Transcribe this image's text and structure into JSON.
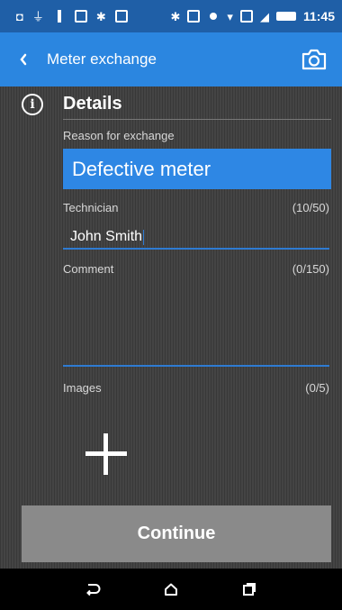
{
  "status_bar": {
    "time": "11:45",
    "icons": [
      "cast-icon",
      "usb-icon",
      "info-icon",
      "screenshot-icon",
      "bluetooth-icon",
      "gallery-icon",
      "bluetooth-icon",
      "nfc-icon",
      "data-icon",
      "wifi-icon",
      "storage-icon",
      "signal-icon",
      "battery-icon"
    ]
  },
  "app_bar": {
    "title": "Meter exchange",
    "back_icon": "back-arrow-icon",
    "camera_icon": "camera-icon"
  },
  "details": {
    "title": "Details",
    "reason_label": "Reason for exchange",
    "reason_value": "Defective meter",
    "technician_label": "Technician",
    "technician_counter": "(10/50)",
    "technician_value": "John Smith",
    "comment_label": "Comment",
    "comment_counter": "(0/150)",
    "comment_value": "",
    "images_label": "Images",
    "images_counter": "(0/5)"
  },
  "continue_label": "Continue",
  "colors": {
    "status_bar": "#1f5fa7",
    "app_bar": "#2b86e0",
    "accent": "#2e87e4",
    "button_disabled": "#8a8a8a",
    "background": "#444444"
  },
  "nav_bar": {
    "icons": [
      "back-icon",
      "home-icon",
      "recents-icon"
    ]
  }
}
